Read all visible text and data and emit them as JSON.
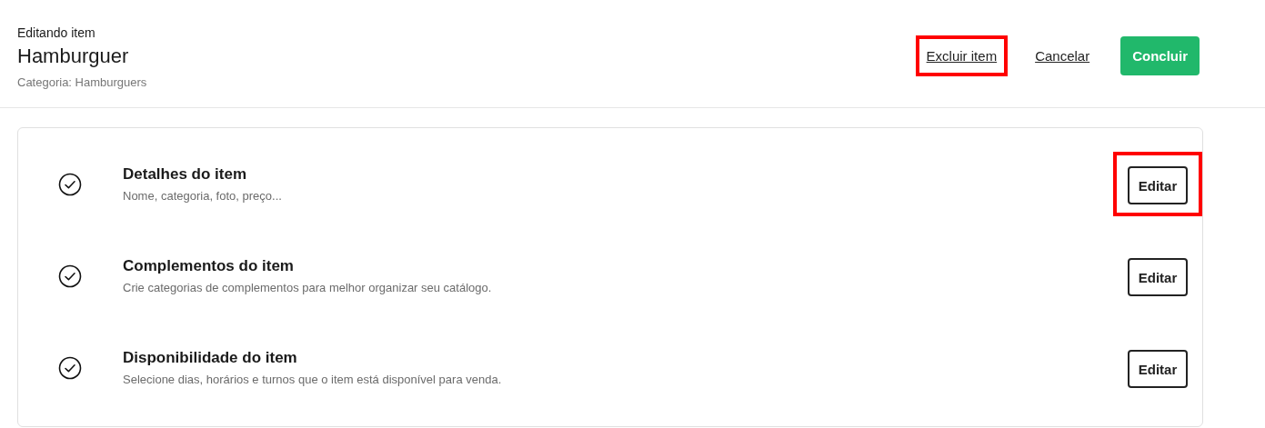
{
  "header": {
    "eyebrow": "Editando item",
    "title": "Hamburguer",
    "category": "Categoria: Hamburguers",
    "actions": [
      {
        "kind": "link",
        "label": "Excluir item",
        "highlighted": true
      },
      {
        "kind": "link",
        "label": "Cancelar",
        "highlighted": false
      },
      {
        "kind": "primary",
        "label": "Concluir",
        "highlighted": false
      }
    ]
  },
  "sections": [
    {
      "title": "Detalhes do item",
      "description": "Nome, categoria, foto, preço...",
      "checked": true,
      "button": "Editar",
      "highlighted": true
    },
    {
      "title": "Complementos do item",
      "description": "Crie categorias de complementos para melhor organizar seu catálogo.",
      "checked": true,
      "button": "Editar",
      "highlighted": false
    },
    {
      "title": "Disponibilidade do item",
      "description": "Selecione dias, horários e turnos que o item está disponível para venda.",
      "checked": true,
      "button": "Editar",
      "highlighted": false
    }
  ]
}
